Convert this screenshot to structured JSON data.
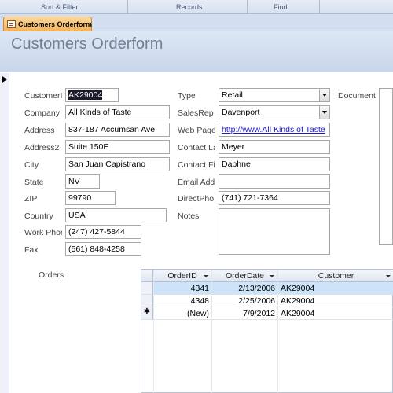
{
  "ribbon": {
    "groups": [
      "Sort & Filter",
      "Records",
      "Find"
    ]
  },
  "tab": {
    "label": "Customers Orderform",
    "icon": "form-icon"
  },
  "form": {
    "title": "Customers Orderform",
    "fields": {
      "customer_id": {
        "label": "CustomerI",
        "value": "AK29004"
      },
      "company": {
        "label": "Company",
        "value": "All Kinds of Taste"
      },
      "address": {
        "label": "Address",
        "value": "837-187 Accumsan Ave"
      },
      "address2": {
        "label": "Address2",
        "value": "Suite 150E"
      },
      "city": {
        "label": "City",
        "value": "San Juan Capistrano"
      },
      "state": {
        "label": "State",
        "value": "NV"
      },
      "zip": {
        "label": "ZIP",
        "value": "99790"
      },
      "country": {
        "label": "Country",
        "value": "USA"
      },
      "work_phone": {
        "label": "Work Phor",
        "value": "(247) 427-5844"
      },
      "fax": {
        "label": "Fax",
        "value": "(561) 848-4258"
      },
      "type": {
        "label": "Type",
        "value": "Retail"
      },
      "salesrep": {
        "label": "SalesRep",
        "value": "Davenport"
      },
      "web_page": {
        "label": "Web Page",
        "value": "http://www.All Kinds of Taste"
      },
      "contact_last": {
        "label": "Contact La",
        "value": "Meyer"
      },
      "contact_first": {
        "label": "Contact Fi",
        "value": "Daphne"
      },
      "email": {
        "label": "Email Add",
        "value": ""
      },
      "direct_phone": {
        "label": "DirectPho",
        "value": "(741) 721-7364"
      },
      "notes": {
        "label": "Notes",
        "value": ""
      },
      "document": {
        "label": "Document"
      }
    }
  },
  "orders": {
    "label": "Orders",
    "columns": [
      "OrderID",
      "OrderDate",
      "Customer"
    ],
    "rows": [
      {
        "order_id": "4341",
        "order_date": "2/13/2006",
        "customer": "AK29004"
      },
      {
        "order_id": "4348",
        "order_date": "2/25/2006",
        "customer": "AK29004"
      },
      {
        "order_id": "(New)",
        "order_date": "7/9/2012",
        "customer": "AK29004"
      }
    ],
    "new_row_marker": "✱"
  }
}
